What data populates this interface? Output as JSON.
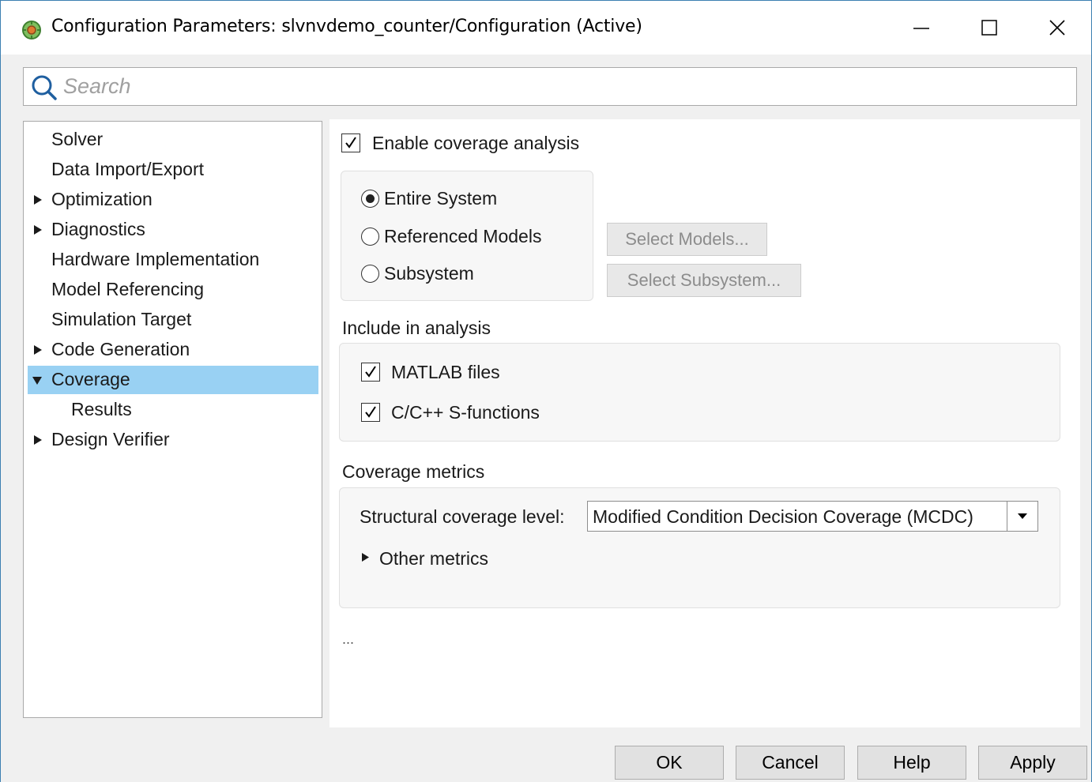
{
  "window": {
    "title": "Configuration Parameters: slvnvdemo_counter/Configuration (Active)"
  },
  "search": {
    "placeholder": "Search",
    "value": ""
  },
  "sidebar": {
    "items": [
      {
        "label": "Solver",
        "expander": "none"
      },
      {
        "label": "Data Import/Export",
        "expander": "none"
      },
      {
        "label": "Optimization",
        "expander": "collapsed"
      },
      {
        "label": "Diagnostics",
        "expander": "collapsed"
      },
      {
        "label": "Hardware Implementation",
        "expander": "none"
      },
      {
        "label": "Model Referencing",
        "expander": "none"
      },
      {
        "label": "Simulation Target",
        "expander": "none"
      },
      {
        "label": "Code Generation",
        "expander": "collapsed"
      },
      {
        "label": "Coverage",
        "expander": "expanded",
        "selected": true
      },
      {
        "label": "Results",
        "expander": "none",
        "child": true
      },
      {
        "label": "Design Verifier",
        "expander": "collapsed"
      }
    ]
  },
  "coverage": {
    "enable_label": "Enable coverage analysis",
    "enable_checked": true,
    "scope_options": [
      {
        "label": "Entire System",
        "selected": true
      },
      {
        "label": "Referenced Models",
        "selected": false
      },
      {
        "label": "Subsystem",
        "selected": false
      }
    ],
    "select_models_label": "Select Models...",
    "select_subsystem_label": "Select Subsystem...",
    "include_heading": "Include in analysis",
    "include_items": [
      {
        "label": "MATLAB files",
        "checked": true
      },
      {
        "label": "C/C++ S-functions",
        "checked": true
      }
    ],
    "metrics_heading": "Coverage metrics",
    "structural_label": "Structural coverage level:",
    "structural_value": "Modified Condition Decision Coverage (MCDC)",
    "other_metrics_label": "Other metrics",
    "ellipsis": "..."
  },
  "footer": {
    "ok_label": "OK",
    "cancel_label": "Cancel",
    "help_label": "Help",
    "apply_label": "Apply"
  },
  "colors": {
    "selection": "#99d1f3",
    "window_border": "#3c7fb1",
    "disabled_text": "#8c8c8c"
  }
}
